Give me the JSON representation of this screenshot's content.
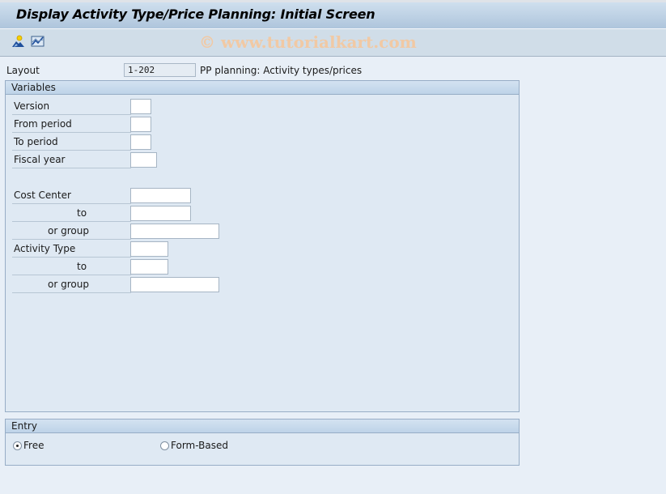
{
  "window": {
    "title": "Display Activity Type/Price Planning: Initial Screen"
  },
  "toolbar": {
    "icons": [
      "personalize-icon",
      "chart-icon"
    ],
    "watermark": "© www.tutorialkart.com"
  },
  "layout": {
    "label": "Layout",
    "value": "1-202",
    "description": "PP planning: Activity types/prices"
  },
  "variables": {
    "title": "Variables",
    "fields": [
      {
        "label": "Version",
        "value": ""
      },
      {
        "label": "From period",
        "value": ""
      },
      {
        "label": "To period",
        "value": ""
      },
      {
        "label": "Fiscal year",
        "value": ""
      },
      {
        "label": "Cost Center",
        "value": ""
      },
      {
        "label": "to",
        "value": ""
      },
      {
        "label": "or group",
        "value": ""
      },
      {
        "label": "Activity Type",
        "value": ""
      },
      {
        "label": "to",
        "value": ""
      },
      {
        "label": "or group",
        "value": ""
      }
    ]
  },
  "entry": {
    "title": "Entry",
    "options": [
      {
        "label": "Free",
        "selected": true
      },
      {
        "label": "Form-Based",
        "selected": false
      }
    ]
  }
}
